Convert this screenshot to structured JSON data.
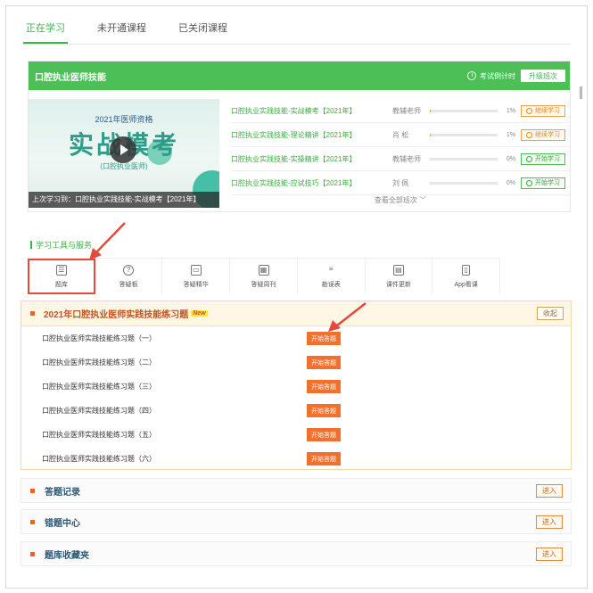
{
  "tabs": [
    {
      "label": "正在学习",
      "active": true
    },
    {
      "label": "未开通课程",
      "active": false
    },
    {
      "label": "已关闭课程",
      "active": false
    }
  ],
  "course": {
    "title": "口腔执业医师技能",
    "countdown_label": "考试倒计时",
    "upgrade_label": "升级班次",
    "banner": {
      "line1": "2021年医师资格",
      "big": "实战模考",
      "sub": "(口腔执业医师)",
      "caption": "上次学习到：口腔执业实践技能-实战模考【2021年】"
    },
    "lessons": [
      {
        "title": "口腔执业实践技能-实战模考【2021年】",
        "teacher": "教辅老师",
        "progress": 1,
        "pct": "1%",
        "action": "继续学习",
        "type": "continue"
      },
      {
        "title": "口腔执业实践技能-理论精讲【2021年】",
        "teacher": "肖  松",
        "progress": 1,
        "pct": "1%",
        "action": "继续学习",
        "type": "continue"
      },
      {
        "title": "口腔执业实践技能-实操精讲【2021年】",
        "teacher": "教辅老师",
        "progress": 0,
        "pct": "0%",
        "action": "开始学习",
        "type": "start"
      },
      {
        "title": "口腔执业实践技能-应试技巧【2021年】",
        "teacher": "刘  佩",
        "progress": 0,
        "pct": "0%",
        "action": "开始学习",
        "type": "start"
      }
    ],
    "view_all": "查看全部班次 ﹀"
  },
  "tools": {
    "label": "学习工具与服务",
    "items": [
      {
        "label": "题库",
        "icon": "list-icon",
        "glyph": "☰"
      },
      {
        "label": "答疑板",
        "icon": "question-icon",
        "glyph": "?"
      },
      {
        "label": "答疑精华",
        "icon": "monitor-icon",
        "glyph": "▭"
      },
      {
        "label": "答疑周刊",
        "icon": "calendar-icon",
        "glyph": "▦"
      },
      {
        "label": "勘误表",
        "icon": "menu-icon",
        "glyph": "≡"
      },
      {
        "label": "课件更新",
        "icon": "document-icon",
        "glyph": "▤"
      },
      {
        "label": "App看课",
        "icon": "phone-icon",
        "glyph": "▯"
      }
    ]
  },
  "question_bank": {
    "title": "2021年口腔执业医师实践技能练习题",
    "badge": "New",
    "collapse_label": "收起",
    "exercises": [
      {
        "title": "口腔执业医师实践技能练习题（一）",
        "action": "开始答题"
      },
      {
        "title": "口腔执业医师实践技能练习题（二）",
        "action": "开始答题"
      },
      {
        "title": "口腔执业医师实践技能练习题（三）",
        "action": "开始答题"
      },
      {
        "title": "口腔执业医师实践技能练习题（四）",
        "action": "开始答题"
      },
      {
        "title": "口腔执业医师实践技能练习题（五）",
        "action": "开始答题"
      },
      {
        "title": "口腔执业医师实践技能练习题（六）",
        "action": "开始答题"
      }
    ]
  },
  "sections": [
    {
      "title": "答题记录",
      "action": "进入"
    },
    {
      "title": "错题中心",
      "action": "进入"
    },
    {
      "title": "题库收藏夹",
      "action": "进入"
    }
  ],
  "colors": {
    "brand_green": "#4cc057",
    "accent_orange": "#f36f2c",
    "annotation_red": "#e24a3b"
  }
}
